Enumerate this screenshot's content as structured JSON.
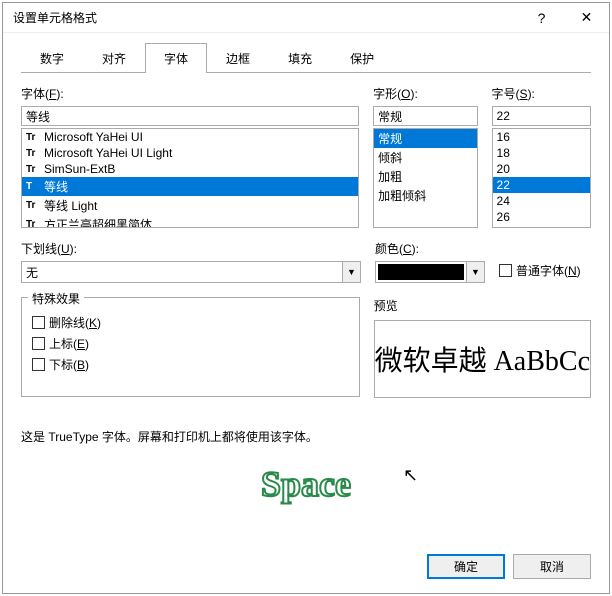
{
  "title": "设置单元格格式",
  "tabs": [
    "数字",
    "对齐",
    "字体",
    "边框",
    "填充",
    "保护"
  ],
  "activeTab": "字体",
  "fontSection": {
    "label": "字体(F):",
    "value": "等线",
    "items": [
      {
        "icon": "Tr",
        "name": "Microsoft YaHei UI"
      },
      {
        "icon": "Tr",
        "name": "Microsoft YaHei UI Light"
      },
      {
        "icon": "Tr",
        "name": "SimSun-ExtB"
      },
      {
        "icon": "T",
        "name": "等线",
        "selected": true
      },
      {
        "icon": "Tr",
        "name": "等线 Light"
      },
      {
        "icon": "Tr",
        "name": "方正兰亭超细黑简体"
      }
    ]
  },
  "styleSection": {
    "label": "字形(O):",
    "value": "常规",
    "items": [
      {
        "name": "常规",
        "selected": true
      },
      {
        "name": "倾斜"
      },
      {
        "name": "加粗"
      },
      {
        "name": "加粗倾斜"
      }
    ]
  },
  "sizeSection": {
    "label": "字号(S):",
    "value": "22",
    "items": [
      {
        "name": "16"
      },
      {
        "name": "18"
      },
      {
        "name": "20"
      },
      {
        "name": "22",
        "selected": true
      },
      {
        "name": "24"
      },
      {
        "name": "26"
      }
    ]
  },
  "underline": {
    "label": "下划线(U):",
    "value": "无"
  },
  "color": {
    "label": "颜色(C):",
    "swatch": "#000000"
  },
  "normalFont": {
    "label": "普通字体(N)",
    "checked": false
  },
  "effects": {
    "title": "特殊效果",
    "strike": "删除线(K)",
    "super": "上标(E)",
    "sub": "下标(B)"
  },
  "preview": {
    "label": "预览",
    "text": "微软卓越  AaBbCc"
  },
  "description": "这是 TrueType 字体。屏幕和打印机上都将使用该字体。",
  "buttons": {
    "ok": "确定",
    "cancel": "取消"
  },
  "watermark": "Space"
}
